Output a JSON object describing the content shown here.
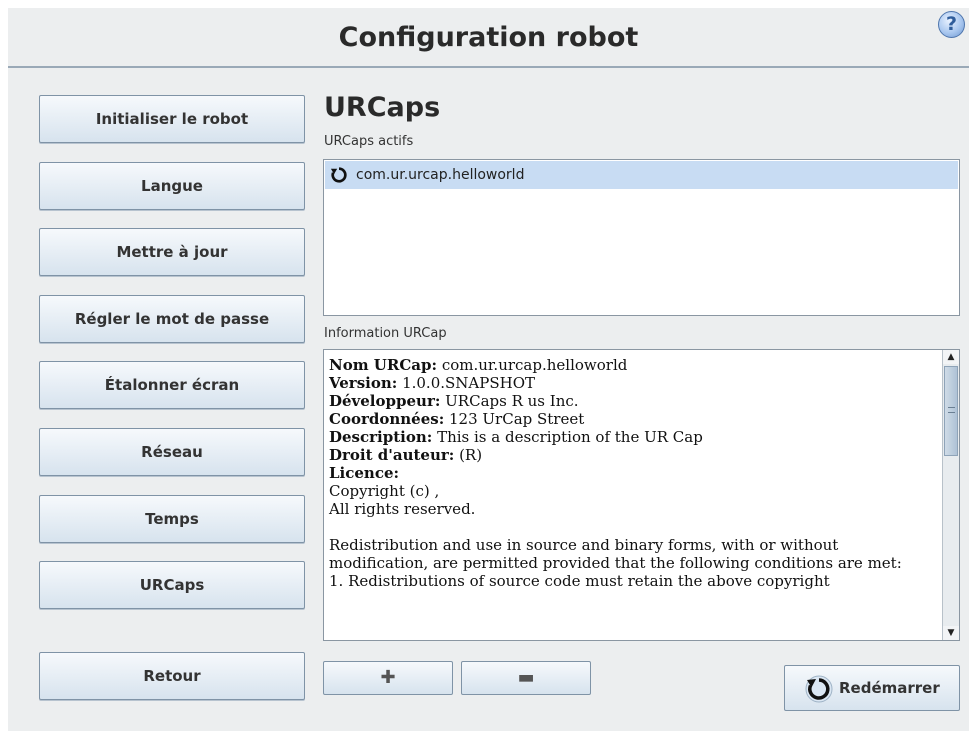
{
  "header": {
    "title": "Configuration robot",
    "help_symbol": "?"
  },
  "nav": {
    "items": [
      {
        "label": "Initialiser le robot"
      },
      {
        "label": "Langue"
      },
      {
        "label": "Mettre à jour"
      },
      {
        "label": "Régler le mot de passe"
      },
      {
        "label": "Étalonner écran"
      },
      {
        "label": "Réseau"
      },
      {
        "label": "Temps"
      },
      {
        "label": "URCaps"
      }
    ],
    "back_label": "Retour"
  },
  "section": {
    "title": "URCaps",
    "active_label": "URCaps actifs",
    "active_items": [
      {
        "name": "com.ur.urcap.helloworld",
        "icon": "reload-icon"
      }
    ],
    "info_label": "Information URCap"
  },
  "info": {
    "name_key": "Nom URCap",
    "name_val": " com.ur.urcap.helloworld",
    "version_key": "Version",
    "version_val": " 1.0.0.SNAPSHOT",
    "dev_key": "Développeur",
    "dev_val": " URCaps R us Inc.",
    "contact_key": "Coordonnées",
    "contact_val": " 123 UrCap Street",
    "desc_key": "Description",
    "desc_val": " This is a description of the UR Cap",
    "copyright_key": "Droit d'auteur",
    "copyright_val": " (R)",
    "license_key": "Licence",
    "license_line1": "Copyright (c) ,",
    "license_line2": "All rights reserved.",
    "license_para": "Redistribution and use in source and binary forms, with or without modification, are permitted provided that the following conditions are met:",
    "license_cut": "1. Redistributions of source code must retain the above copyright"
  },
  "buttons": {
    "add_symbol": "✚",
    "remove_symbol": "▬",
    "restart_label": "Redémarrer"
  },
  "colors": {
    "selection": "#c8dcf3",
    "button_top": "#f6f9fc",
    "button_bottom": "#d7e3ee"
  }
}
